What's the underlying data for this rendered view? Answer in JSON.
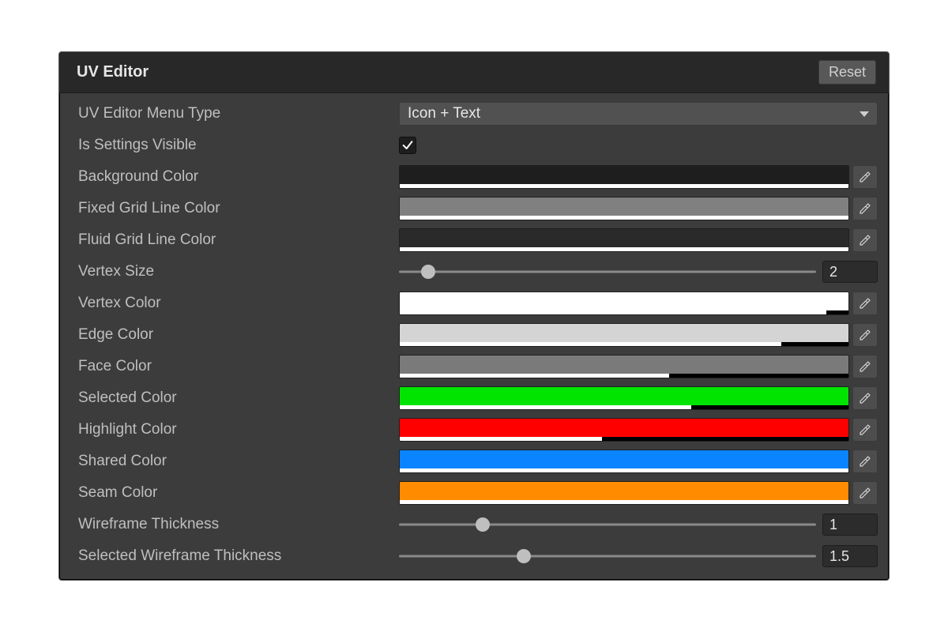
{
  "header": {
    "title": "UV Editor",
    "reset_label": "Reset"
  },
  "rows": {
    "menuType": {
      "label": "UV Editor Menu Type",
      "value": "Icon + Text"
    },
    "settingsVis": {
      "label": "Is Settings Visible",
      "checked": true
    },
    "bgColor": {
      "label": "Background Color",
      "color": "#1e1e1e",
      "alpha": 100
    },
    "fixedGrid": {
      "label": "Fixed Grid Line Color",
      "color": "#808080",
      "alpha": 100
    },
    "fluidGrid": {
      "label": "Fluid Grid Line Color",
      "color": "#2a2a2a",
      "alpha": 100
    },
    "vertexSize": {
      "label": "Vertex Size",
      "value": 2,
      "display": "2",
      "min": 0,
      "max": 20,
      "pos": 7
    },
    "vertexColor": {
      "label": "Vertex Color",
      "color": "#ffffff",
      "alpha": 95
    },
    "edgeColor": {
      "label": "Edge Color",
      "color": "#d4d4d4",
      "alpha": 85
    },
    "faceColor": {
      "label": "Face Color",
      "color": "#7a7a7a",
      "alpha": 60
    },
    "selColor": {
      "label": "Selected Color",
      "color": "#00e400",
      "alpha": 65
    },
    "hiColor": {
      "label": "Highlight Color",
      "color": "#ff0000",
      "alpha": 45
    },
    "sharedColor": {
      "label": "Shared Color",
      "color": "#0a84ff",
      "alpha": 100
    },
    "seamColor": {
      "label": "Seam Color",
      "color": "#ff8c00",
      "alpha": 100
    },
    "wireThk": {
      "label": "Wireframe Thickness",
      "value": 1,
      "display": "1",
      "min": 0,
      "max": 5,
      "pos": 20
    },
    "selWireThk": {
      "label": "Selected Wireframe Thickness",
      "value": 1.5,
      "display": "1.5",
      "min": 0,
      "max": 5,
      "pos": 30
    }
  }
}
